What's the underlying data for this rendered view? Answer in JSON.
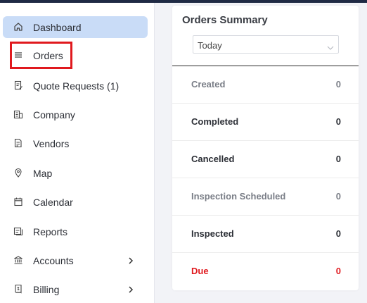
{
  "sidebar": {
    "items": [
      {
        "label": "Dashboard",
        "icon": "home-icon"
      },
      {
        "label": "Orders",
        "icon": "list-icon"
      },
      {
        "label": "Quote Requests (1)",
        "icon": "file-edit-icon"
      },
      {
        "label": "Company",
        "icon": "building-icon"
      },
      {
        "label": "Vendors",
        "icon": "document-icon"
      },
      {
        "label": "Map",
        "icon": "map-pin-icon"
      },
      {
        "label": "Calendar",
        "icon": "calendar-icon"
      },
      {
        "label": "Reports",
        "icon": "reports-icon"
      },
      {
        "label": "Accounts",
        "icon": "bank-icon"
      },
      {
        "label": "Billing",
        "icon": "invoice-icon"
      }
    ]
  },
  "orders_summary": {
    "title": "Orders Summary",
    "period": "Today",
    "rows": [
      {
        "label": "Created",
        "value": "0",
        "color": "#7a7e87"
      },
      {
        "label": "Completed",
        "value": "0",
        "color": "#2c2f36"
      },
      {
        "label": "Cancelled",
        "value": "0",
        "color": "#2c2f36"
      },
      {
        "label": "Inspection Scheduled",
        "value": "0",
        "color": "#7a7e87"
      },
      {
        "label": "Inspected",
        "value": "0",
        "color": "#2c2f36"
      },
      {
        "label": "Due",
        "value": "0",
        "color": "#e0191e"
      }
    ]
  },
  "colors": {
    "active_nav_bg": "#c9dcf7",
    "highlight_border": "#e0191e",
    "due_text": "#e0191e"
  }
}
